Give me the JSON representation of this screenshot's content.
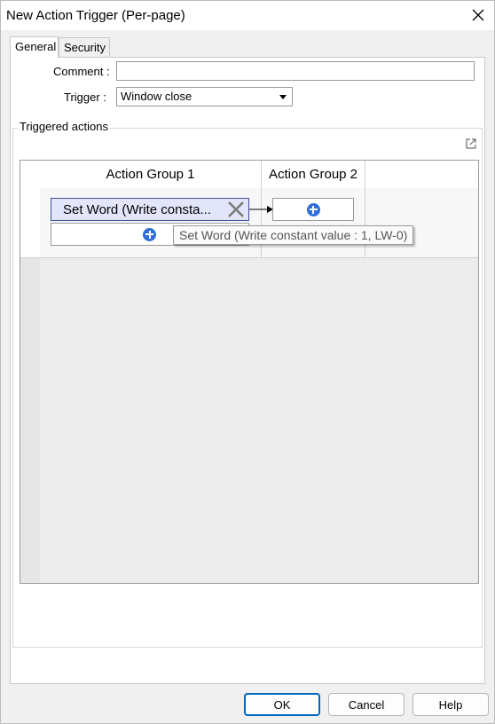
{
  "window": {
    "title": "New Action Trigger (Per-page)"
  },
  "tabs": [
    {
      "label": "General",
      "active": true
    },
    {
      "label": "Security",
      "active": false
    }
  ],
  "form": {
    "comment_label": "Comment :",
    "comment_value": "",
    "trigger_label": "Trigger :",
    "trigger_value": "Window close"
  },
  "triggered_actions": {
    "label": "Triggered actions",
    "groups": [
      {
        "header": "Action Group 1",
        "actions": [
          {
            "label": "Set Word (Write consta..."
          }
        ]
      },
      {
        "header": "Action Group 2",
        "actions": []
      }
    ],
    "tooltip": "Set Word (Write constant value : 1, LW-0)"
  },
  "buttons": {
    "ok": "OK",
    "cancel": "Cancel",
    "help": "Help"
  },
  "colors": {
    "accent": "#0067c0",
    "add_icon": "#2f6fdb",
    "selected_action_bg": "#e3e6fb",
    "selected_action_border": "#3b4f9e"
  },
  "icons": {
    "close": "close-icon",
    "delete": "x-icon",
    "add": "plus-circle-icon",
    "popout": "popout-icon",
    "dropdown": "chevron-down-icon"
  }
}
